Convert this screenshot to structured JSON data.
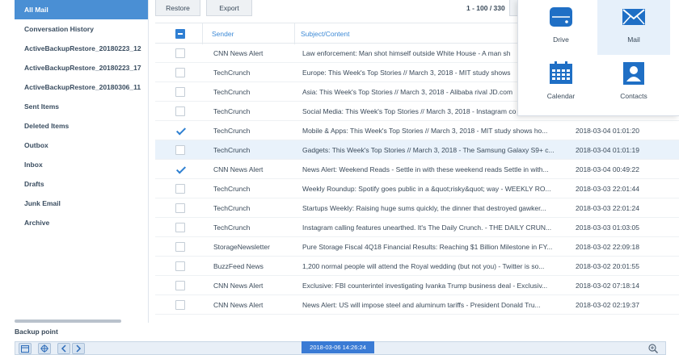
{
  "sidebar": {
    "items": [
      {
        "label": "All Mail",
        "active": true
      },
      {
        "label": "Conversation History"
      },
      {
        "label": "ActiveBackupRestore_20180223_12"
      },
      {
        "label": "ActiveBackupRestore_20180223_17"
      },
      {
        "label": "ActiveBackupRestore_20180306_11"
      },
      {
        "label": "Sent Items"
      },
      {
        "label": "Deleted Items"
      },
      {
        "label": "Outbox"
      },
      {
        "label": "Inbox"
      },
      {
        "label": "Drafts"
      },
      {
        "label": "Junk Email"
      },
      {
        "label": "Archive"
      }
    ]
  },
  "toolbar": {
    "restore_label": "Restore",
    "export_label": "Export",
    "pager_text": "1 - 100 / 330"
  },
  "table": {
    "headers": {
      "sender": "Sender",
      "subject": "Subject/Content"
    },
    "rows": [
      {
        "checked": false,
        "sender": "CNN News Alert",
        "subject": "Law enforcement: Man shot himself outside White House - A man sh",
        "date": ""
      },
      {
        "checked": false,
        "sender": "TechCrunch",
        "subject": "Europe: This Week's Top Stories // March 3, 2018 - MIT study shows",
        "date": ""
      },
      {
        "checked": false,
        "sender": "TechCrunch",
        "subject": "Asia: This Week's Top Stories // March 3, 2018 - Alibaba rival JD.com",
        "date": ""
      },
      {
        "checked": false,
        "sender": "TechCrunch",
        "subject": "Social Media: This Week's Top Stories // March 3, 2018 - Instagram co",
        "date": ""
      },
      {
        "checked": true,
        "sender": "TechCrunch",
        "subject": "Mobile & Apps: This Week's Top Stories // March 3, 2018 - MIT study shows ho...",
        "date": "2018-03-04 01:01:20"
      },
      {
        "checked": false,
        "sender": "TechCrunch",
        "subject": "Gadgets: This Week's Top Stories // March 3, 2018 - The Samsung Galaxy S9+ c...",
        "date": "2018-03-04 01:01:19",
        "highlight": true
      },
      {
        "checked": true,
        "sender": "CNN News Alert",
        "subject": "News Alert: Weekend Reads - Settle in with these weekend reads Settle in with...",
        "date": "2018-03-04 00:49:22"
      },
      {
        "checked": false,
        "sender": "TechCrunch",
        "subject": "Weekly Roundup: Spotify goes public in a &quot;risky&quot; way - WEEKLY RO...",
        "date": "2018-03-03 22:01:44"
      },
      {
        "checked": false,
        "sender": "TechCrunch",
        "subject": "Startups Weekly: Raising huge sums quickly, the dinner that destroyed gawker...",
        "date": "2018-03-03 22:01:24"
      },
      {
        "checked": false,
        "sender": "TechCrunch",
        "subject": "Instagram calling features unearthed. It's The Daily Crunch. - THE DAILY CRUN...",
        "date": "2018-03-03 01:03:05"
      },
      {
        "checked": false,
        "sender": "StorageNewsletter",
        "subject": "Pure Storage Fiscal 4Q18 Financial Results: Reaching $1 Billion Milestone in FY...",
        "date": "2018-03-02 22:09:18"
      },
      {
        "checked": false,
        "sender": "BuzzFeed News",
        "subject": "1,200 normal people will attend the Royal wedding (but not you) - Twitter is so...",
        "date": "2018-03-02 20:01:55"
      },
      {
        "checked": false,
        "sender": "CNN News Alert",
        "subject": "Exclusive: FBI counterintel investigating Ivanka Trump business deal - Exclusiv...",
        "date": "2018-03-02 07:18:14"
      },
      {
        "checked": false,
        "sender": "CNN News Alert",
        "subject": "News Alert: US will impose steel and aluminum tariffs - President Donald Tru...",
        "date": "2018-03-02 02:19:37"
      }
    ]
  },
  "app_switcher": {
    "tiles": [
      {
        "label": "Drive",
        "icon": "drive-icon"
      },
      {
        "label": "Mail",
        "icon": "mail-icon",
        "selected": true
      },
      {
        "label": "Calendar",
        "icon": "calendar-icon"
      },
      {
        "label": "Contacts",
        "icon": "contacts-icon"
      }
    ]
  },
  "backup": {
    "label": "Backup point",
    "current_point": "2018-03-06 14:26:24"
  },
  "colors": {
    "accent": "#4a8fd4",
    "icon_blue": "#1f6fc5",
    "check": "#2d7fd1",
    "header_text": "#3d8ad6"
  }
}
